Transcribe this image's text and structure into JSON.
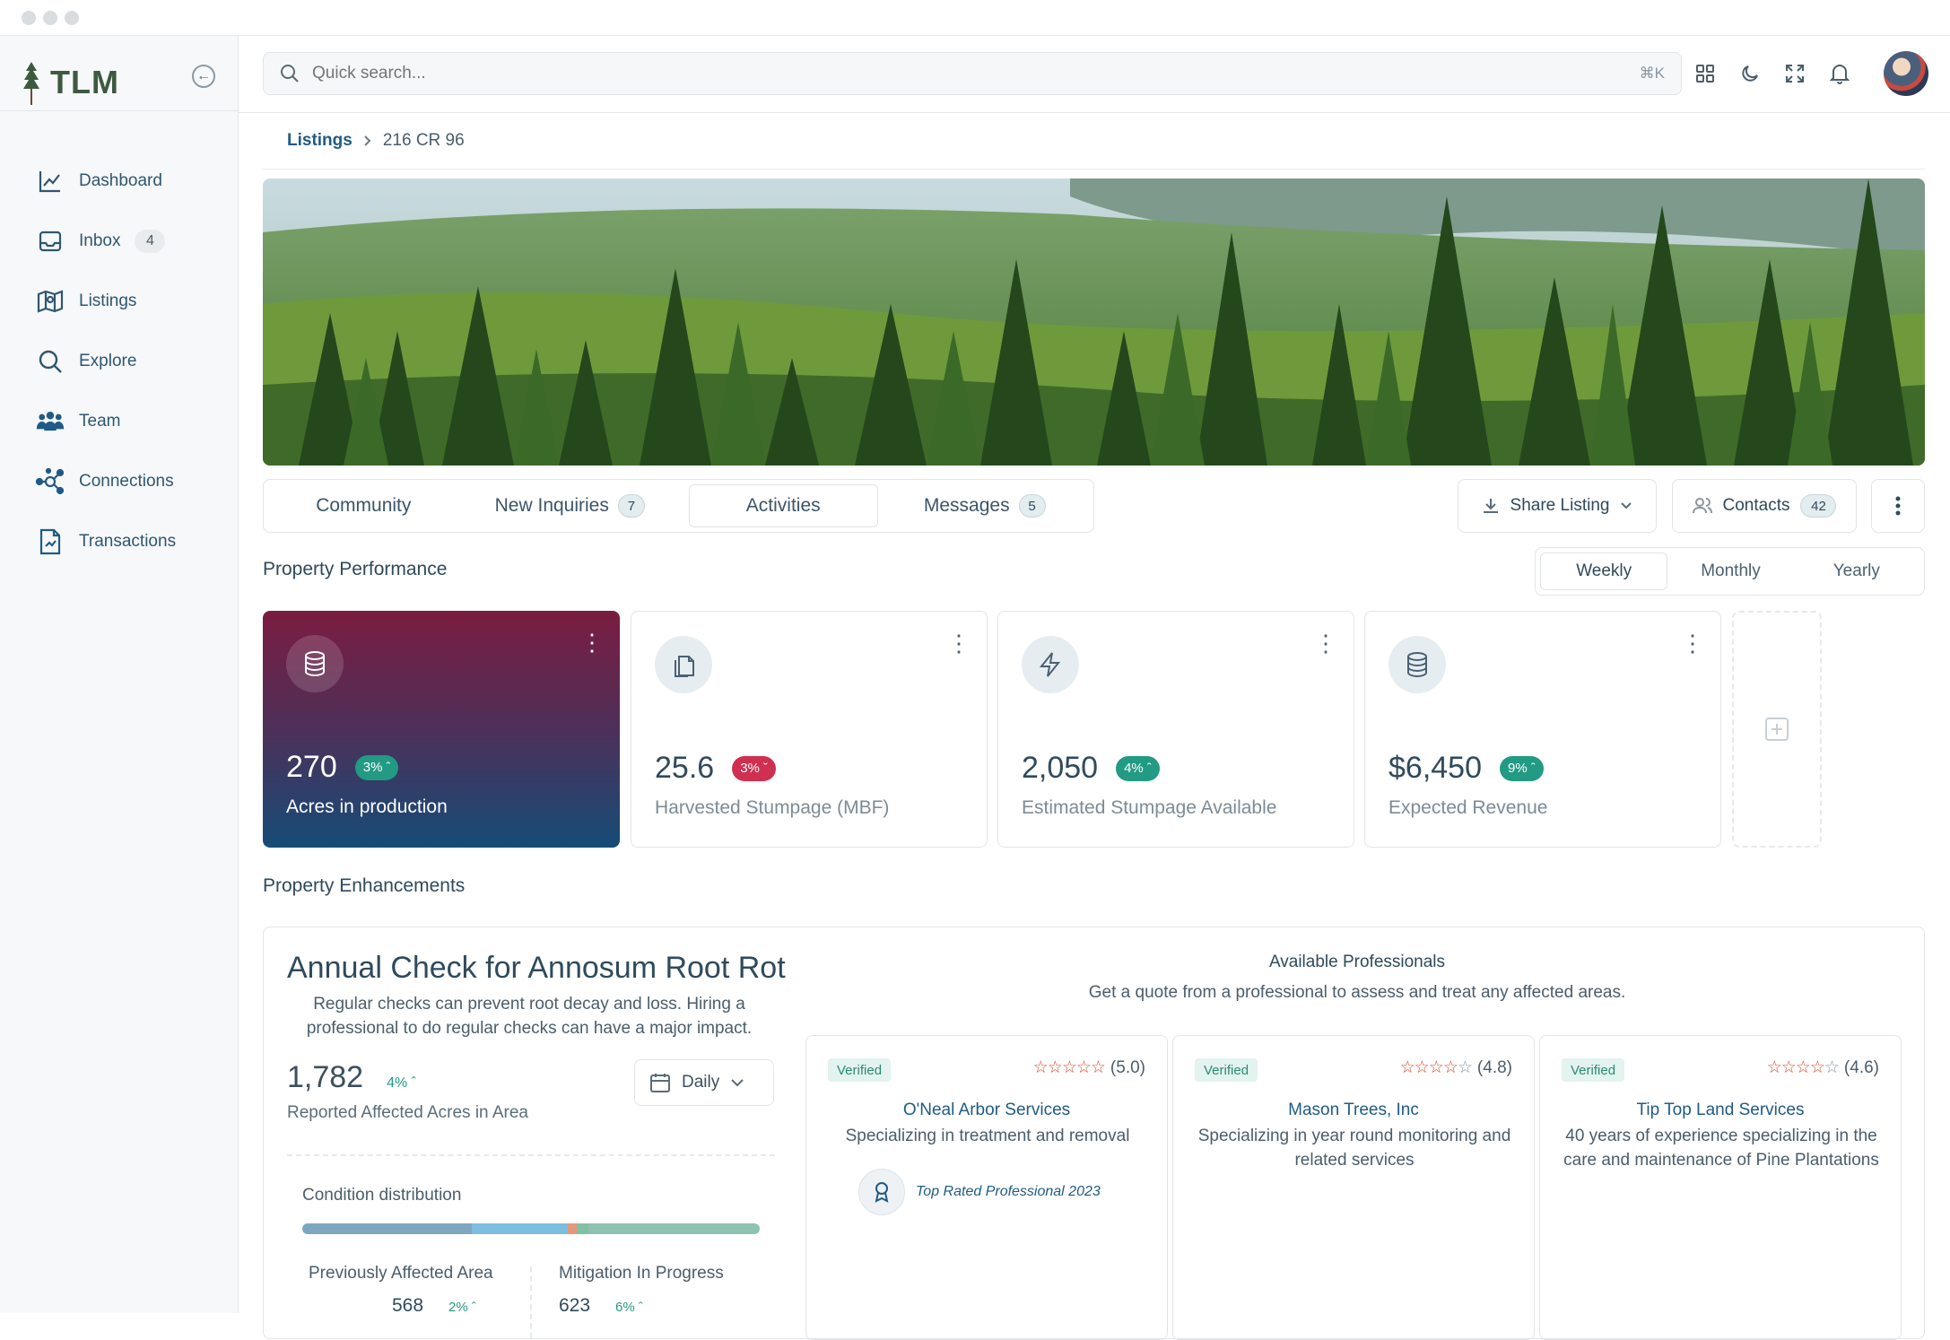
{
  "app": {
    "brand": "TLM"
  },
  "sidebar": {
    "items": [
      {
        "label": "Dashboard",
        "icon": "chart-line-icon"
      },
      {
        "label": "Inbox",
        "icon": "inbox-icon",
        "badge": "4"
      },
      {
        "label": "Listings",
        "icon": "map-icon"
      },
      {
        "label": "Explore",
        "icon": "search-icon"
      },
      {
        "label": "Team",
        "icon": "team-icon"
      },
      {
        "label": "Connections",
        "icon": "connections-icon"
      },
      {
        "label": "Transactions",
        "icon": "document-icon"
      }
    ]
  },
  "search": {
    "placeholder": "Quick search...",
    "shortcut": "⌘K"
  },
  "breadcrumb": {
    "parent": "Listings",
    "current": "216 CR 96"
  },
  "tabs": [
    {
      "label": "Community"
    },
    {
      "label": "New Inquiries",
      "badge": "7"
    },
    {
      "label": "Activities"
    },
    {
      "label": "Messages",
      "badge": "5"
    }
  ],
  "actions": {
    "share": "Share Listing",
    "contacts": "Contacts",
    "contacts_count": "42"
  },
  "performance": {
    "title": "Property  Performance",
    "periods": [
      "Weekly",
      "Monthly",
      "Yearly"
    ],
    "selected_period": "Weekly",
    "cards": [
      {
        "value": "270",
        "change": "3%",
        "direction": "up",
        "label": "Acres in production",
        "icon": "database-icon"
      },
      {
        "value": "25.6",
        "change": "3%",
        "direction": "down",
        "label": "Harvested Stumpage (MBF)",
        "icon": "documents-icon"
      },
      {
        "value": "2,050",
        "change": "4%",
        "direction": "up",
        "label": "Estimated Stumpage Available",
        "icon": "lightning-icon"
      },
      {
        "value": "$6,450",
        "change": "9%",
        "direction": "up",
        "label": "Expected Revenue",
        "icon": "database-icon"
      }
    ]
  },
  "enhancements": {
    "title": "Property  Enhancements",
    "check": {
      "title": "Annual Check for Annosum Root Rot",
      "description": "Regular checks can prevent root decay and loss. Hiring a professional to do regular checks can have a major impact.",
      "value": "1,782",
      "change": "4%",
      "sublabel": "Reported Affected Acres in Area",
      "range": "Daily",
      "condition_label": "Condition distribution",
      "condition_segments": [
        {
          "fraction": 0.37,
          "color": "#7fa6bf"
        },
        {
          "fraction": 0.21,
          "color": "#7cbde0"
        },
        {
          "fraction": 0.02,
          "color": "#e2987a"
        },
        {
          "fraction": 0.025,
          "color": "#82c0a6"
        },
        {
          "fraction": 0.375,
          "color": "#8fc2b0"
        }
      ],
      "stats": [
        {
          "label": "Previously Affected Area",
          "value": "568",
          "change": "2%"
        },
        {
          "label": "Mitigation In Progress",
          "value": "623",
          "change": "6%"
        }
      ]
    },
    "professionals": {
      "title": "Available Professionals",
      "subtitle": "Get a quote from a professional to assess  and treat any affected areas.",
      "items": [
        {
          "verified": "Verified",
          "stars": 5,
          "rating": "(5.0)",
          "name": "O'Neal Arbor Services",
          "description": "Specializing in treatment and removal",
          "award": "Top Rated Professional 2023"
        },
        {
          "verified": "Verified",
          "stars": 4,
          "rating": "(4.8)",
          "name": "Mason Trees, Inc",
          "description": "Specializing in year round monitoring and related services"
        },
        {
          "verified": "Verified",
          "stars": 4,
          "rating": "(4.6)",
          "name": "Tip Top Land Services",
          "description": "40 years of experience specializing in the care and maintenance of Pine Plantations"
        }
      ]
    }
  },
  "colors": {
    "accent": "#1f5b85",
    "positive": "#229a84",
    "negative": "#d03050",
    "brand": "#3d5a40"
  }
}
